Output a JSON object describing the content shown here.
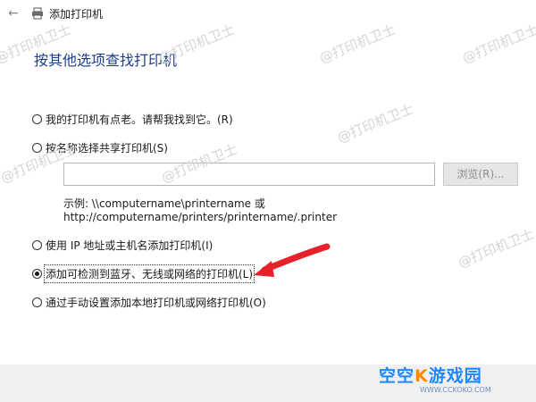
{
  "window": {
    "title": "添加打印机",
    "back_glyph": "←"
  },
  "heading": "按其他选项查找打印机",
  "options": [
    {
      "label": "我的打印机有点老。请帮我找到它。(R)",
      "checked": false
    },
    {
      "label": "按名称选择共享打印机(S)",
      "checked": false
    },
    {
      "label": "使用 IP 地址或主机名添加打印机(I)",
      "checked": false
    },
    {
      "label": "添加可检测到蓝牙、无线或网络的打印机(L)",
      "checked": true
    },
    {
      "label": "通过手动设置添加本地打印机或网络打印机(O)",
      "checked": false
    }
  ],
  "shared_printer": {
    "input_value": "",
    "browse_label": "浏览(R)...",
    "example_line1": "示例: \\\\computername\\printername 或",
    "example_line2": "http://computername/printers/printername/.printer"
  },
  "watermark": "@打印机卫士",
  "logo": {
    "brand_left": "空空",
    "brand_k": "K",
    "brand_right": "游戏园",
    "url": "WWW.CCKOKO.COM"
  },
  "colors": {
    "heading": "#1d3e8c",
    "arrow": "#e8202a",
    "logo_blue": "#1e88ff",
    "logo_orange": "#ff8a00"
  }
}
